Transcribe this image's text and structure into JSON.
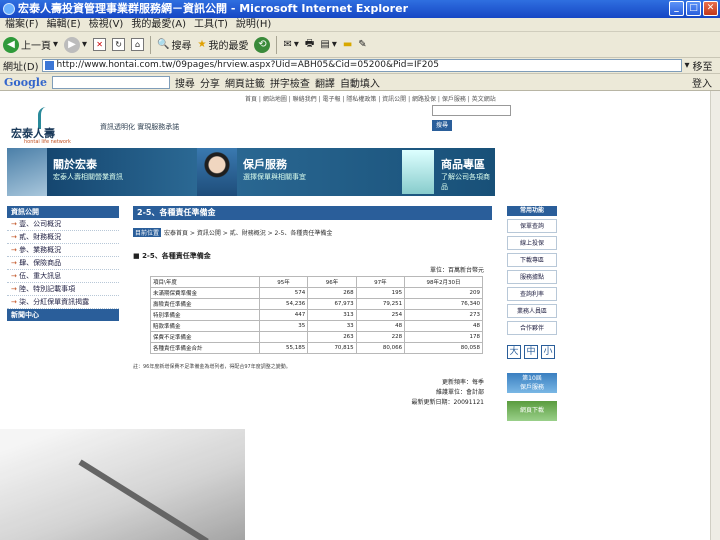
{
  "window": {
    "title": "宏泰人壽投資管理事業群服務網－資訊公開 - Microsoft Internet Explorer",
    "min": "_",
    "max": "□",
    "close": "✕"
  },
  "menu": [
    "檔案(F)",
    "編輯(E)",
    "檢視(V)",
    "我的最愛(A)",
    "工具(T)",
    "說明(H)"
  ],
  "toolbar": {
    "back": "上一頁",
    "search": "搜尋",
    "favorites": "我的最愛"
  },
  "address": {
    "label": "網址(D)",
    "url": "http://www.hontai.com.tw/09pages/hrview.aspx?Uid=ABH05&Cid=05200&Pid=IF205",
    "go": "移至"
  },
  "googlebar": {
    "logo": "Google",
    "search": "搜尋",
    "share": "分享",
    "bookmarks": "網頁註籤",
    "spell": "拼字檢查",
    "translate": "翻譯",
    "autofill": "自動填入",
    "login": "登入"
  },
  "site": {
    "top_links": "首頁 | 網站地圖 | 聯絡我們 | 電子報 | 隱私權政策 | 資訊公開 | 網路投保 | 保戶服務 | 英文網站",
    "logo_text": "宏泰人壽",
    "logo_sub": "hontai life network",
    "slogan": "資訊透明化 實現服務承諾",
    "search_btn": "搜尋",
    "banners": [
      {
        "title": "關於宏泰",
        "sub": "宏泰人壽相關營業資訊"
      },
      {
        "title": "保戶服務",
        "sub": "選擇保單與相關事宜"
      },
      {
        "title": "商品專區",
        "sub": "了解公司各項商品"
      }
    ]
  },
  "leftnav": {
    "head": "資訊公開",
    "items": [
      "壹、公司概況",
      "貳、財務概況",
      "參、業務概況",
      "肆、保險商品",
      "伍、重大訊息",
      "陸、特別記載事項",
      "柒、分紅保單資訊揭露"
    ],
    "foot": "新聞中心"
  },
  "main": {
    "title": "2-5、各種責任準備金",
    "crumb_tag": "目前位置",
    "crumb": "宏泰首頁 > 資訊公開 > 貳、財務概況 > 2-5、各種責任準備金",
    "subtitle": "2-5、各種責任準備金",
    "unit": "單位：百萬新台幣元",
    "headers": [
      "項目\\年度",
      "95年",
      "96年",
      "97年",
      "98年2月30日"
    ],
    "rows": [
      [
        "未滿期保費準備金",
        "574",
        "268",
        "195",
        "209"
      ],
      [
        "壽險責任準備金",
        "54,236",
        "67,973",
        "79,251",
        "76,340"
      ],
      [
        "特別準備金",
        "447",
        "313",
        "254",
        "273"
      ],
      [
        "賠款準備金",
        "35",
        "33",
        "48",
        "48"
      ],
      [
        "保費不足準備金",
        "",
        "263",
        "228",
        "178"
      ],
      [
        "各種責任準備金合計",
        "55,185",
        "70,815",
        "80,066",
        "80,058"
      ]
    ],
    "note": "註：96年度新增保費不足準備金為增列者，得配合97年度調整之變動。",
    "footer": [
      "更新頻率：每季",
      "維護單位：會計部",
      "最新更新日期：20091121"
    ]
  },
  "rightnav": {
    "head": "常用功能",
    "items": [
      "保單查詢",
      "線上投保",
      "下載專區",
      "服務據點",
      "查詢利率",
      "業務人員區",
      "合作夥伴"
    ],
    "size_buttons": [
      "大",
      "中",
      "小"
    ],
    "promo": "第10屆\n保戶服務",
    "download": "網頁下載"
  }
}
